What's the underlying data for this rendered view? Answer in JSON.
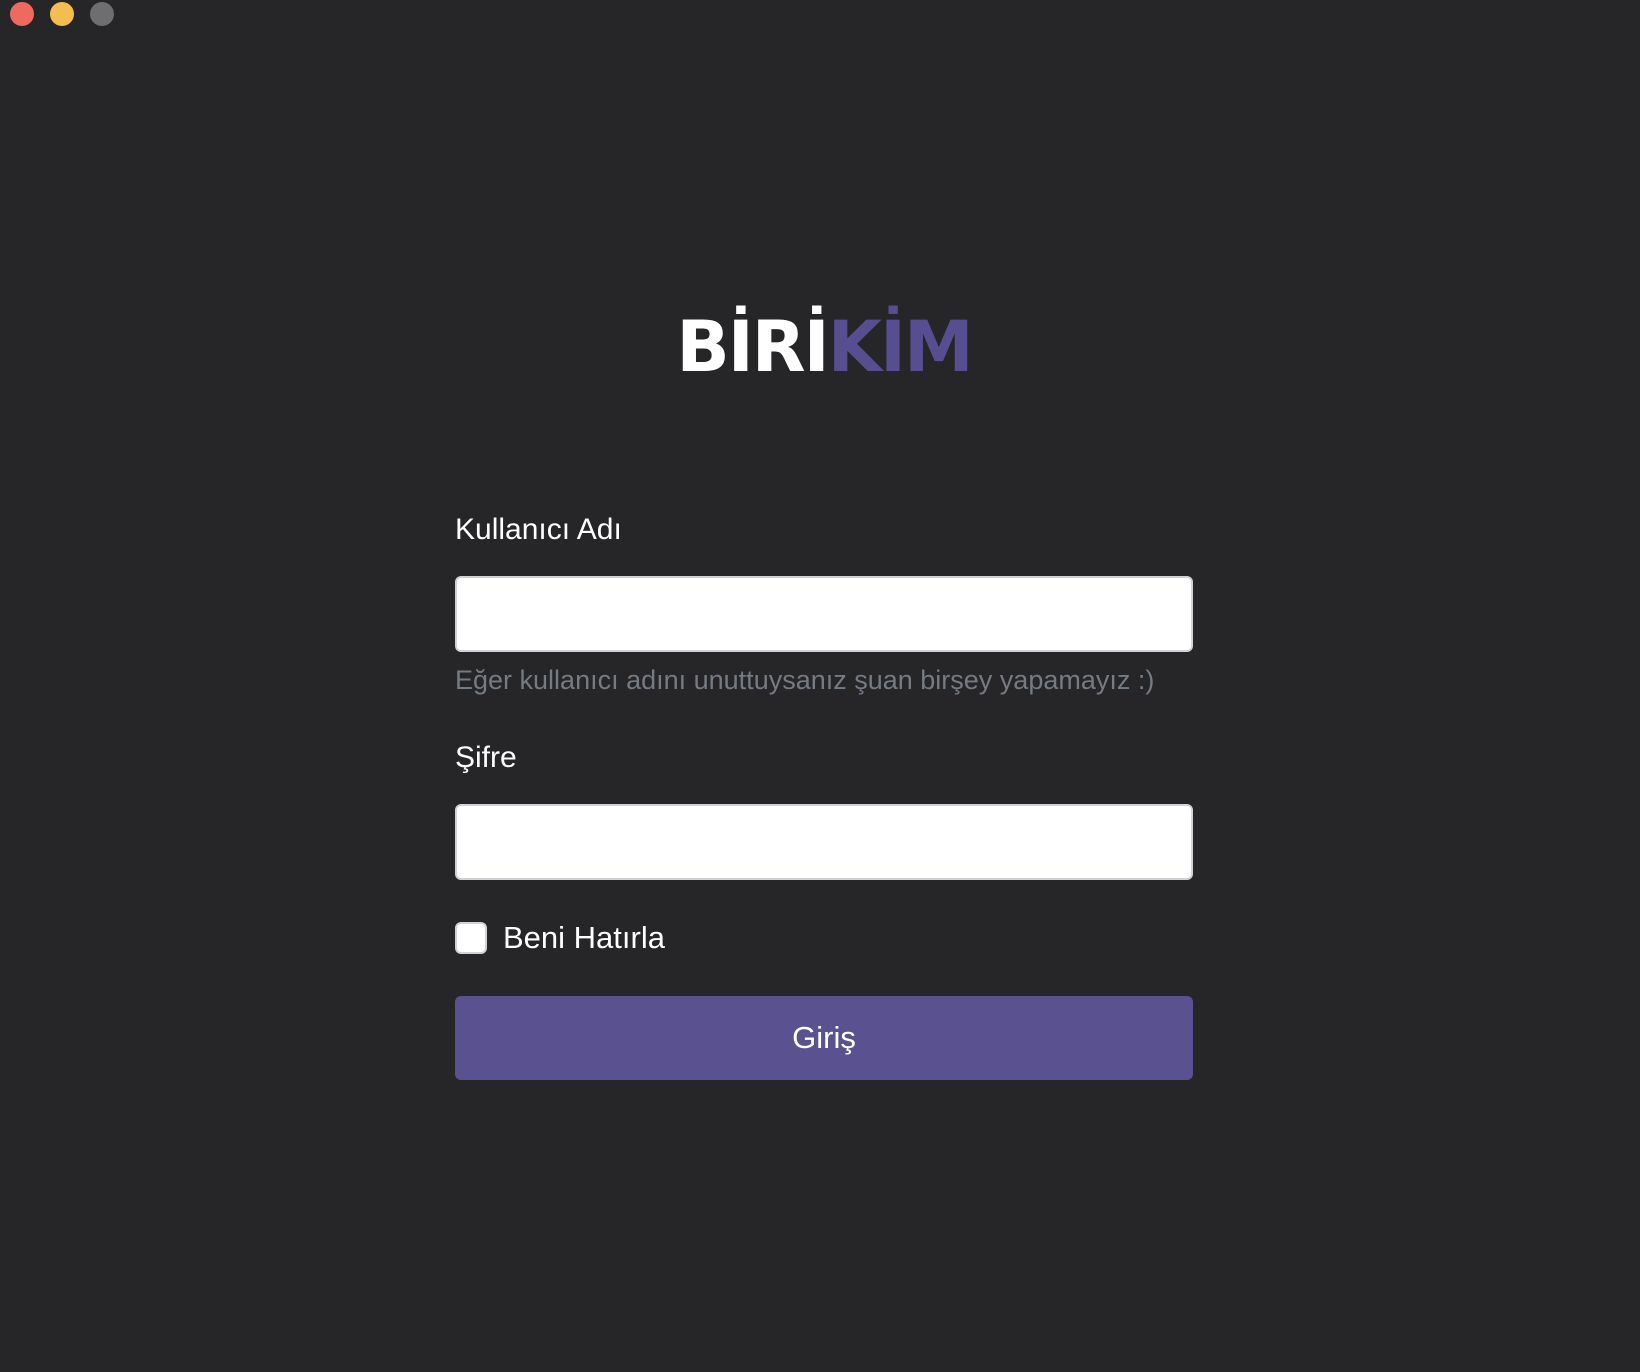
{
  "window": {
    "controls": [
      {
        "name": "close",
        "color": "#ee6a5f"
      },
      {
        "name": "minimize",
        "color": "#f5bd4f"
      },
      {
        "name": "zoom",
        "color": "#6e6d70"
      }
    ]
  },
  "logo": {
    "part_a": "BİRİ",
    "part_b": "KİM"
  },
  "form": {
    "username_label": "Kullanıcı Adı",
    "username_value": "",
    "username_help": "Eğer kullanıcı adını unuttuysanız şuan birşey yapamayız :)",
    "password_label": "Şifre",
    "password_value": "",
    "remember_label": "Beni Hatırla",
    "remember_checked": false,
    "submit_label": "Giriş"
  },
  "colors": {
    "background": "#262527",
    "accent": "#5a5190",
    "logo_accent": "#564e90",
    "help_text": "#757b83"
  }
}
